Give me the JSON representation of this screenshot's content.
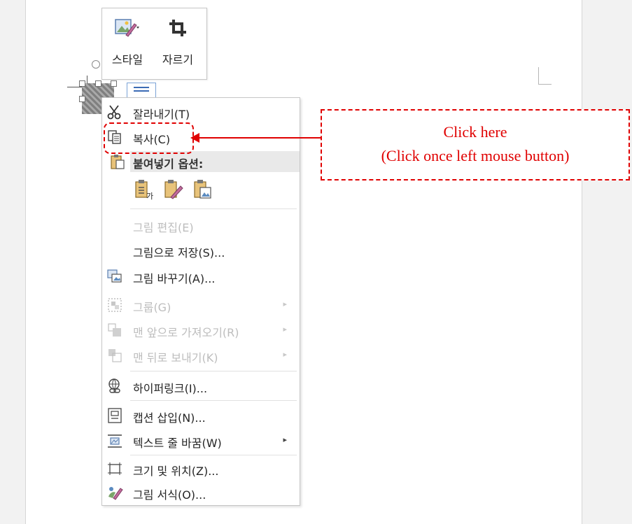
{
  "mini_toolbar": {
    "buttons": [
      {
        "label": "스타일",
        "icon": "picture-style-icon"
      },
      {
        "label": "자르기",
        "icon": "crop-icon"
      }
    ]
  },
  "context_menu": {
    "items": [
      {
        "label": "잘라내기(T)",
        "icon": "scissors-icon",
        "enabled": true
      },
      {
        "label": "복사(C)",
        "icon": "copy-icon",
        "enabled": true
      },
      {
        "label": "붙여넣기 옵션:",
        "icon": "clipboard-icon",
        "header": true
      },
      {
        "label": "그림 편집(E)",
        "enabled": false
      },
      {
        "label": "그림으로 저장(S)...",
        "enabled": true
      },
      {
        "label": "그림 바꾸기(A)...",
        "icon": "change-picture-icon",
        "enabled": true
      },
      {
        "label": "그룹(G)",
        "icon": "group-icon",
        "enabled": false,
        "submenu": true
      },
      {
        "label": "맨 앞으로 가져오기(R)",
        "icon": "bring-to-front-icon",
        "enabled": false,
        "submenu": true
      },
      {
        "label": "맨 뒤로 보내기(K)",
        "icon": "send-to-back-icon",
        "enabled": false,
        "submenu": true
      },
      {
        "label": "하이퍼링크(I)...",
        "icon": "hyperlink-icon",
        "enabled": true
      },
      {
        "label": "캡션 삽입(N)...",
        "icon": "insert-caption-icon",
        "enabled": true
      },
      {
        "label": "텍스트 줄 바꿈(W)",
        "icon": "wrap-text-icon",
        "enabled": true,
        "submenu": true
      },
      {
        "label": "크기 및 위치(Z)...",
        "icon": "size-position-icon",
        "enabled": true
      },
      {
        "label": "그림 서식(O)...",
        "icon": "format-picture-icon",
        "enabled": true
      }
    ],
    "paste_options": [
      "keep-text-only-icon",
      "merge-formatting-icon",
      "picture-paste-icon"
    ],
    "submenu_arrow": "▸"
  },
  "annotation": {
    "line1": "Click here",
    "line2": "(Click once left mouse button)",
    "color": "#e00000"
  }
}
